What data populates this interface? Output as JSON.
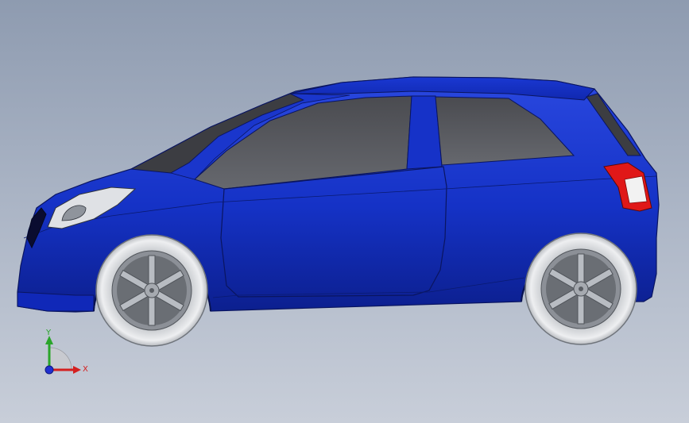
{
  "triad": {
    "y_label": "Y",
    "x_label": "X",
    "y_color": "#2aa52a",
    "x_color": "#d42020",
    "z_color": "#2030d0"
  },
  "model": {
    "body_color": "#1530c8",
    "glass_color": "#5a5c62",
    "tail_light_color": "#e01818",
    "tire_color": "#e6e8ea",
    "rim_color": "#9ea2a8"
  }
}
